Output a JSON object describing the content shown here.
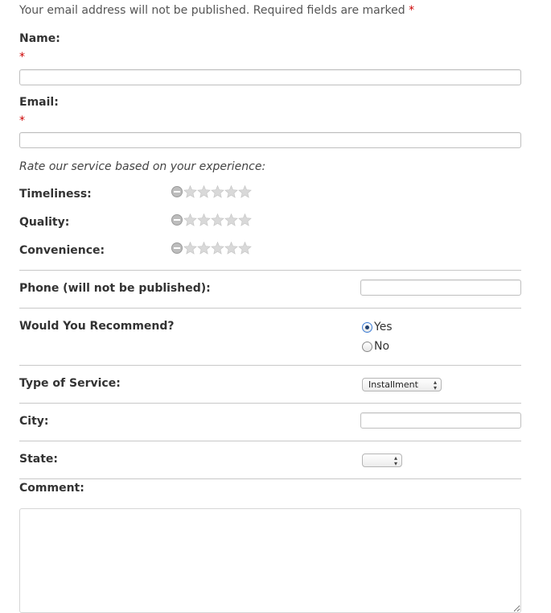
{
  "notice": {
    "text": "Your email address will not be published. Required fields are marked",
    "required_marker": "*"
  },
  "fields": {
    "name": {
      "label": "Name:",
      "required_marker": "*",
      "value": ""
    },
    "email": {
      "label": "Email:",
      "required_marker": "*",
      "value": ""
    }
  },
  "rating_intro": "Rate our service based on your experience:",
  "ratings": [
    {
      "label": "Timeliness:",
      "value": 0,
      "max": 5
    },
    {
      "label": "Quality:",
      "value": 0,
      "max": 5
    },
    {
      "label": "Convenience:",
      "value": 0,
      "max": 5
    }
  ],
  "phone": {
    "label": "Phone (will not be published):",
    "value": ""
  },
  "recommend": {
    "label": "Would You Recommend?",
    "options": [
      "Yes",
      "No"
    ],
    "selected": "Yes"
  },
  "service_type": {
    "label": "Type of Service:",
    "selected": "Installment"
  },
  "city": {
    "label": "City:",
    "value": ""
  },
  "state": {
    "label": "State:",
    "selected": ""
  },
  "comment": {
    "label": "Comment:",
    "value": ""
  },
  "colors": {
    "required": "#cc0000",
    "radio_accent": "#3a7bd5",
    "divider": "#c8c8c8"
  }
}
